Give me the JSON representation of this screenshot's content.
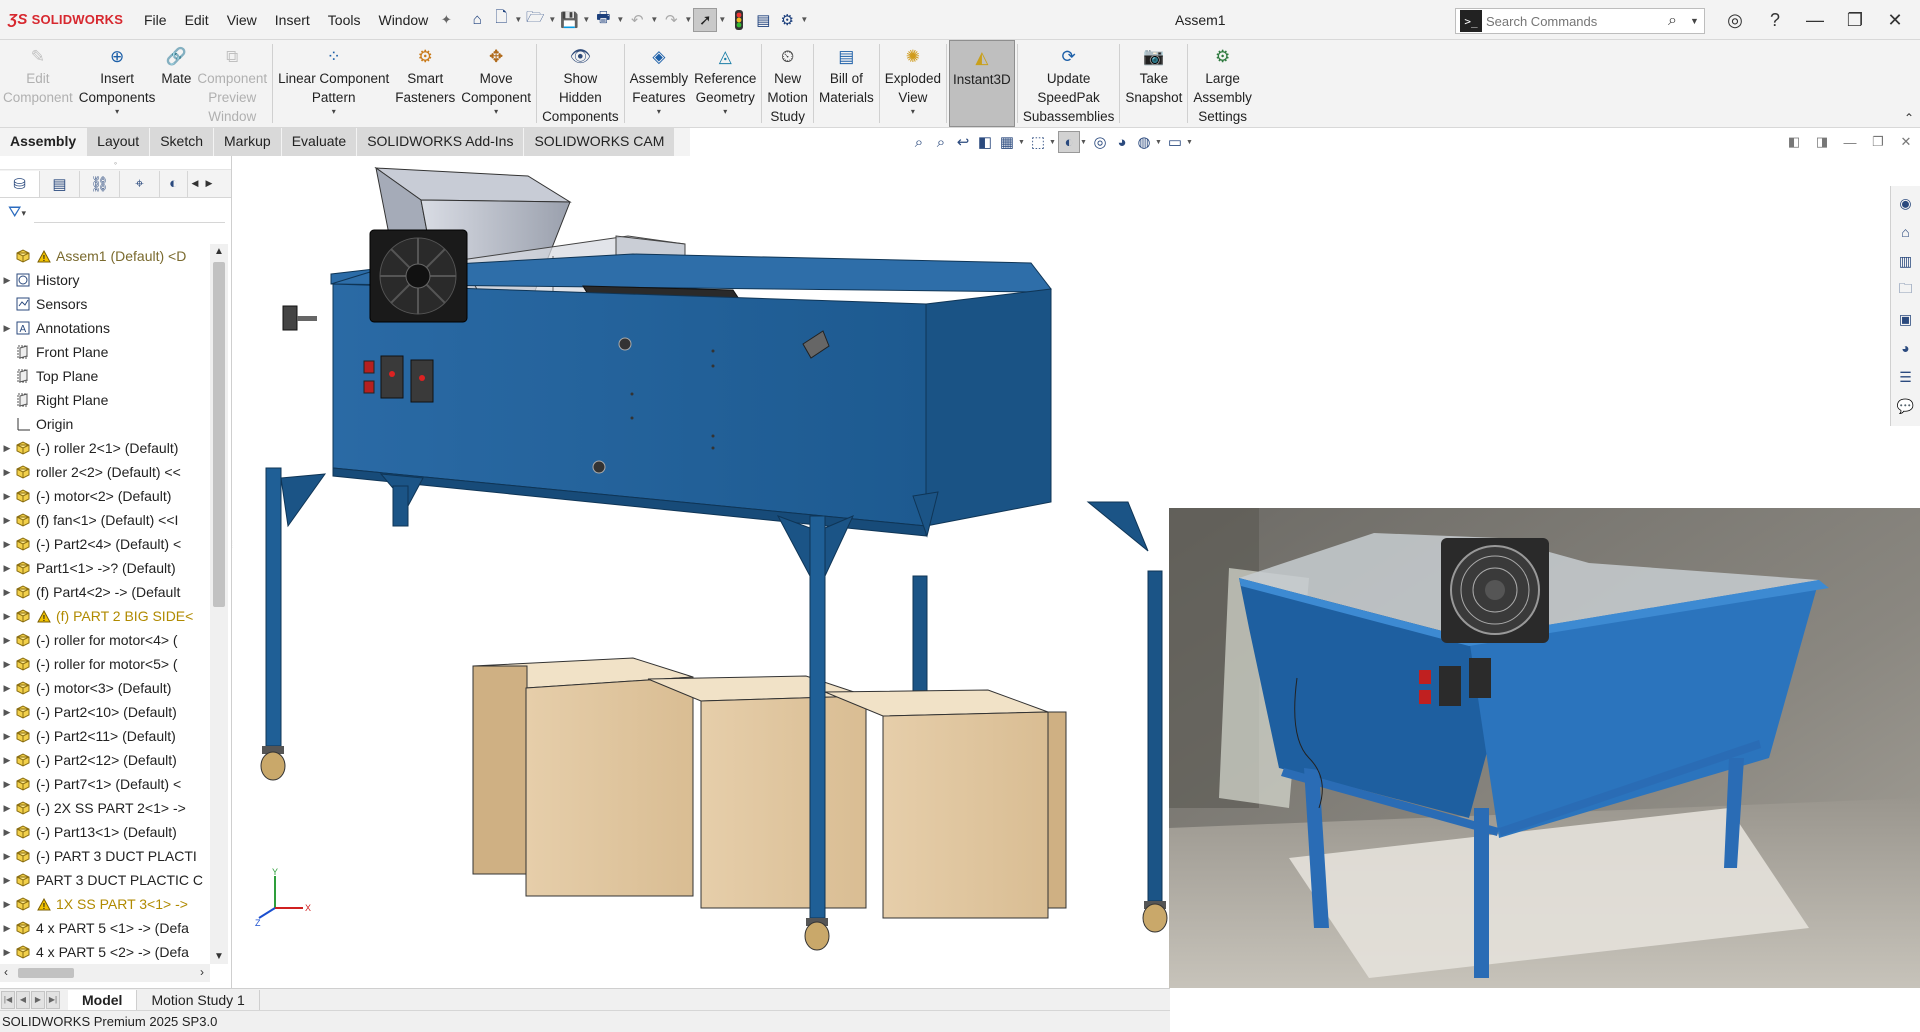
{
  "app": {
    "brand": "SOLIDWORKS",
    "document_title": "Assem1"
  },
  "menu": [
    "File",
    "Edit",
    "View",
    "Insert",
    "Tools",
    "Window"
  ],
  "search": {
    "placeholder": "Search Commands"
  },
  "ribbon": {
    "buttons": [
      {
        "label": "Edit\nComponent",
        "icon": "edit-component-icon",
        "disabled": true
      },
      {
        "label": "Insert\nComponents",
        "icon": "insert-components-icon",
        "caret": true
      },
      {
        "label": "Mate",
        "icon": "mate-icon"
      },
      {
        "label": "Component\nPreview\nWindow",
        "icon": "component-preview-icon",
        "disabled": true
      },
      {
        "label": "Linear Component\nPattern",
        "icon": "linear-pattern-icon",
        "caret": true
      },
      {
        "label": "Smart\nFasteners",
        "icon": "smart-fasteners-icon"
      },
      {
        "label": "Move\nComponent",
        "icon": "move-component-icon",
        "caret": true
      },
      {
        "label": "Show\nHidden\nComponents",
        "icon": "show-hidden-icon"
      },
      {
        "label": "Assembly\nFeatures",
        "icon": "assembly-features-icon",
        "caret": true
      },
      {
        "label": "Reference\nGeometry",
        "icon": "reference-geometry-icon",
        "caret": true
      },
      {
        "label": "New\nMotion\nStudy",
        "icon": "motion-study-icon"
      },
      {
        "label": "Bill of\nMaterials",
        "icon": "bom-icon"
      },
      {
        "label": "Exploded\nView",
        "icon": "exploded-view-icon",
        "caret": true
      },
      {
        "label": "Instant3D",
        "icon": "instant3d-icon",
        "active": true
      },
      {
        "label": "Update\nSpeedPak\nSubassemblies",
        "icon": "speedpak-icon"
      },
      {
        "label": "Take\nSnapshot",
        "icon": "snapshot-icon"
      },
      {
        "label": "Large\nAssembly\nSettings",
        "icon": "large-assembly-icon"
      }
    ]
  },
  "tabs": [
    "Assembly",
    "Layout",
    "Sketch",
    "Markup",
    "Evaluate",
    "SOLIDWORKS Add-Ins",
    "SOLIDWORKS CAM"
  ],
  "feature_tree": {
    "items": [
      {
        "label": "Assem1 (Default) <D",
        "icon": "assembly-icon",
        "warn": true,
        "root": true
      },
      {
        "label": "History",
        "icon": "history-icon",
        "expand": true
      },
      {
        "label": "Sensors",
        "icon": "sensors-icon"
      },
      {
        "label": "Annotations",
        "icon": "annotations-icon",
        "expand": true
      },
      {
        "label": "Front Plane",
        "icon": "plane-icon"
      },
      {
        "label": "Top Plane",
        "icon": "plane-icon"
      },
      {
        "label": "Right Plane",
        "icon": "plane-icon"
      },
      {
        "label": "Origin",
        "icon": "origin-icon"
      },
      {
        "label": "(-) roller 2<1> (Default)",
        "icon": "part-icon",
        "expand": true
      },
      {
        "label": "roller 2<2> (Default) <<",
        "icon": "part-icon",
        "expand": true
      },
      {
        "label": "(-) motor<2> (Default)",
        "icon": "part-icon",
        "expand": true
      },
      {
        "label": "(f) fan<1> (Default) <<I",
        "icon": "part-icon",
        "expand": true
      },
      {
        "label": "(-) Part2<4> (Default) <",
        "icon": "part-icon",
        "expand": true
      },
      {
        "label": "Part1<1> ->? (Default)",
        "icon": "part-icon",
        "expand": true
      },
      {
        "label": "(f) Part4<2> -> (Default",
        "icon": "part-icon",
        "expand": true
      },
      {
        "label": "(f) PART 2 BIG SIDE<",
        "icon": "part-icon",
        "expand": true,
        "warn": true
      },
      {
        "label": "(-) roller for motor<4> (",
        "icon": "part-icon",
        "expand": true
      },
      {
        "label": "(-) roller for motor<5> (",
        "icon": "part-icon",
        "expand": true
      },
      {
        "label": "(-) motor<3> (Default)",
        "icon": "part-icon",
        "expand": true
      },
      {
        "label": "(-) Part2<10> (Default)",
        "icon": "part-icon",
        "expand": true
      },
      {
        "label": "(-) Part2<11> (Default)",
        "icon": "part-icon",
        "expand": true
      },
      {
        "label": "(-) Part2<12> (Default)",
        "icon": "part-icon",
        "expand": true
      },
      {
        "label": "(-) Part7<1> (Default) <",
        "icon": "part-icon",
        "expand": true
      },
      {
        "label": "(-) 2X SS PART 2<1> ->",
        "icon": "part-icon",
        "expand": true
      },
      {
        "label": "(-) Part13<1> (Default)",
        "icon": "part-icon",
        "expand": true
      },
      {
        "label": "(-) PART 3 DUCT PLACTI",
        "icon": "part-icon",
        "expand": true
      },
      {
        "label": "PART 3 DUCT PLACTIC C",
        "icon": "part-icon",
        "expand": true
      },
      {
        "label": "1X SS PART 3<1> ->",
        "icon": "part-icon",
        "expand": true,
        "warn": true
      },
      {
        "label": "4 x PART 5 <1> -> (Defa",
        "icon": "part-icon",
        "expand": true
      },
      {
        "label": "4 x PART 5 <2> -> (Defa",
        "icon": "part-icon",
        "expand": true
      }
    ]
  },
  "triad": {
    "x": "X",
    "y": "Y",
    "z": "Z"
  },
  "bottom_tabs": [
    "Model",
    "Motion Study 1"
  ],
  "status_text": "SOLIDWORKS Premium 2025 SP3.0",
  "colors": {
    "machine_blue": "#1f5f96",
    "box_wood": "#e2c8a2",
    "brand_red": "#d7282f"
  }
}
